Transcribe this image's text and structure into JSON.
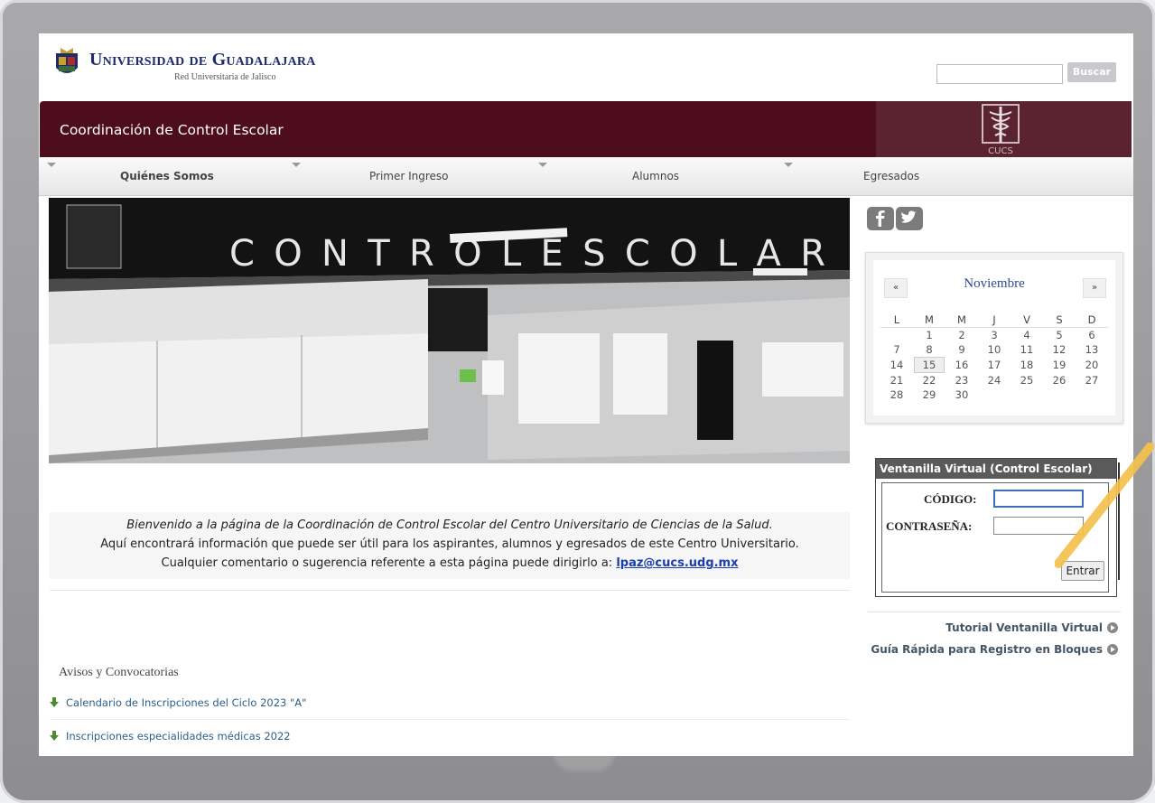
{
  "header": {
    "university": "Universidad de Guadalajara",
    "subtitle": "Red Universitaria de Jalisco",
    "search_placeholder": "",
    "search_button": "Buscar"
  },
  "banner": {
    "title": "Coordinación de Control Escolar",
    "logo_text": "CUCS"
  },
  "nav": [
    {
      "label": "Quiénes Somos"
    },
    {
      "label": "Primer Ingreso"
    },
    {
      "label": "Alumnos"
    },
    {
      "label": "Egresados"
    }
  ],
  "photo": {
    "sign": "C O N T R O L   E S C O L A R"
  },
  "welcome": {
    "line1": "Bienvenido a la página de la Coordinación de Control Escolar del Centro Universitario de Ciencias de la Salud.",
    "line2": "Aquí encontrará información que puede ser útil para los aspirantes, alumnos y egresados de este Centro Universitario.",
    "line3": "Cualquier comentario o sugerencia referente a esta página puede dirigirlo a: ",
    "email": "lpaz@cucs.udg.mx"
  },
  "avisos": {
    "title": "Avisos y Convocatorias",
    "items": [
      "Calendario de Inscripciones del Ciclo 2023 \"A\"",
      "Inscripciones especialidades médicas 2022"
    ]
  },
  "calendar": {
    "month": "Noviembre",
    "prev": "«",
    "next": "»",
    "weekdays": [
      "L",
      "M",
      "M",
      "J",
      "V",
      "S",
      "D"
    ],
    "weeks": [
      [
        "",
        "1",
        "2",
        "3",
        "4",
        "5",
        "6"
      ],
      [
        "7",
        "8",
        "9",
        "10",
        "11",
        "12",
        "13"
      ],
      [
        "14",
        "15",
        "16",
        "17",
        "18",
        "19",
        "20"
      ],
      [
        "21",
        "22",
        "23",
        "24",
        "25",
        "26",
        "27"
      ],
      [
        "28",
        "29",
        "30",
        "",
        "",
        "",
        ""
      ]
    ],
    "today": "15"
  },
  "login": {
    "header": "Ventanilla Virtual (Control Escolar)",
    "codigo_label": "CÓDIGO:",
    "password_label": "CONTRASEÑA:",
    "codigo_value": "",
    "password_value": "",
    "submit": "Entrar"
  },
  "links": {
    "tutorial": "Tutorial Ventanilla Virtual",
    "guia": "Guía Rápida para Registro en Bloques"
  },
  "colors": {
    "banner": "#4e0d1c",
    "link": "#2b5f8a",
    "highlight_arrow": "#f3c14e"
  }
}
